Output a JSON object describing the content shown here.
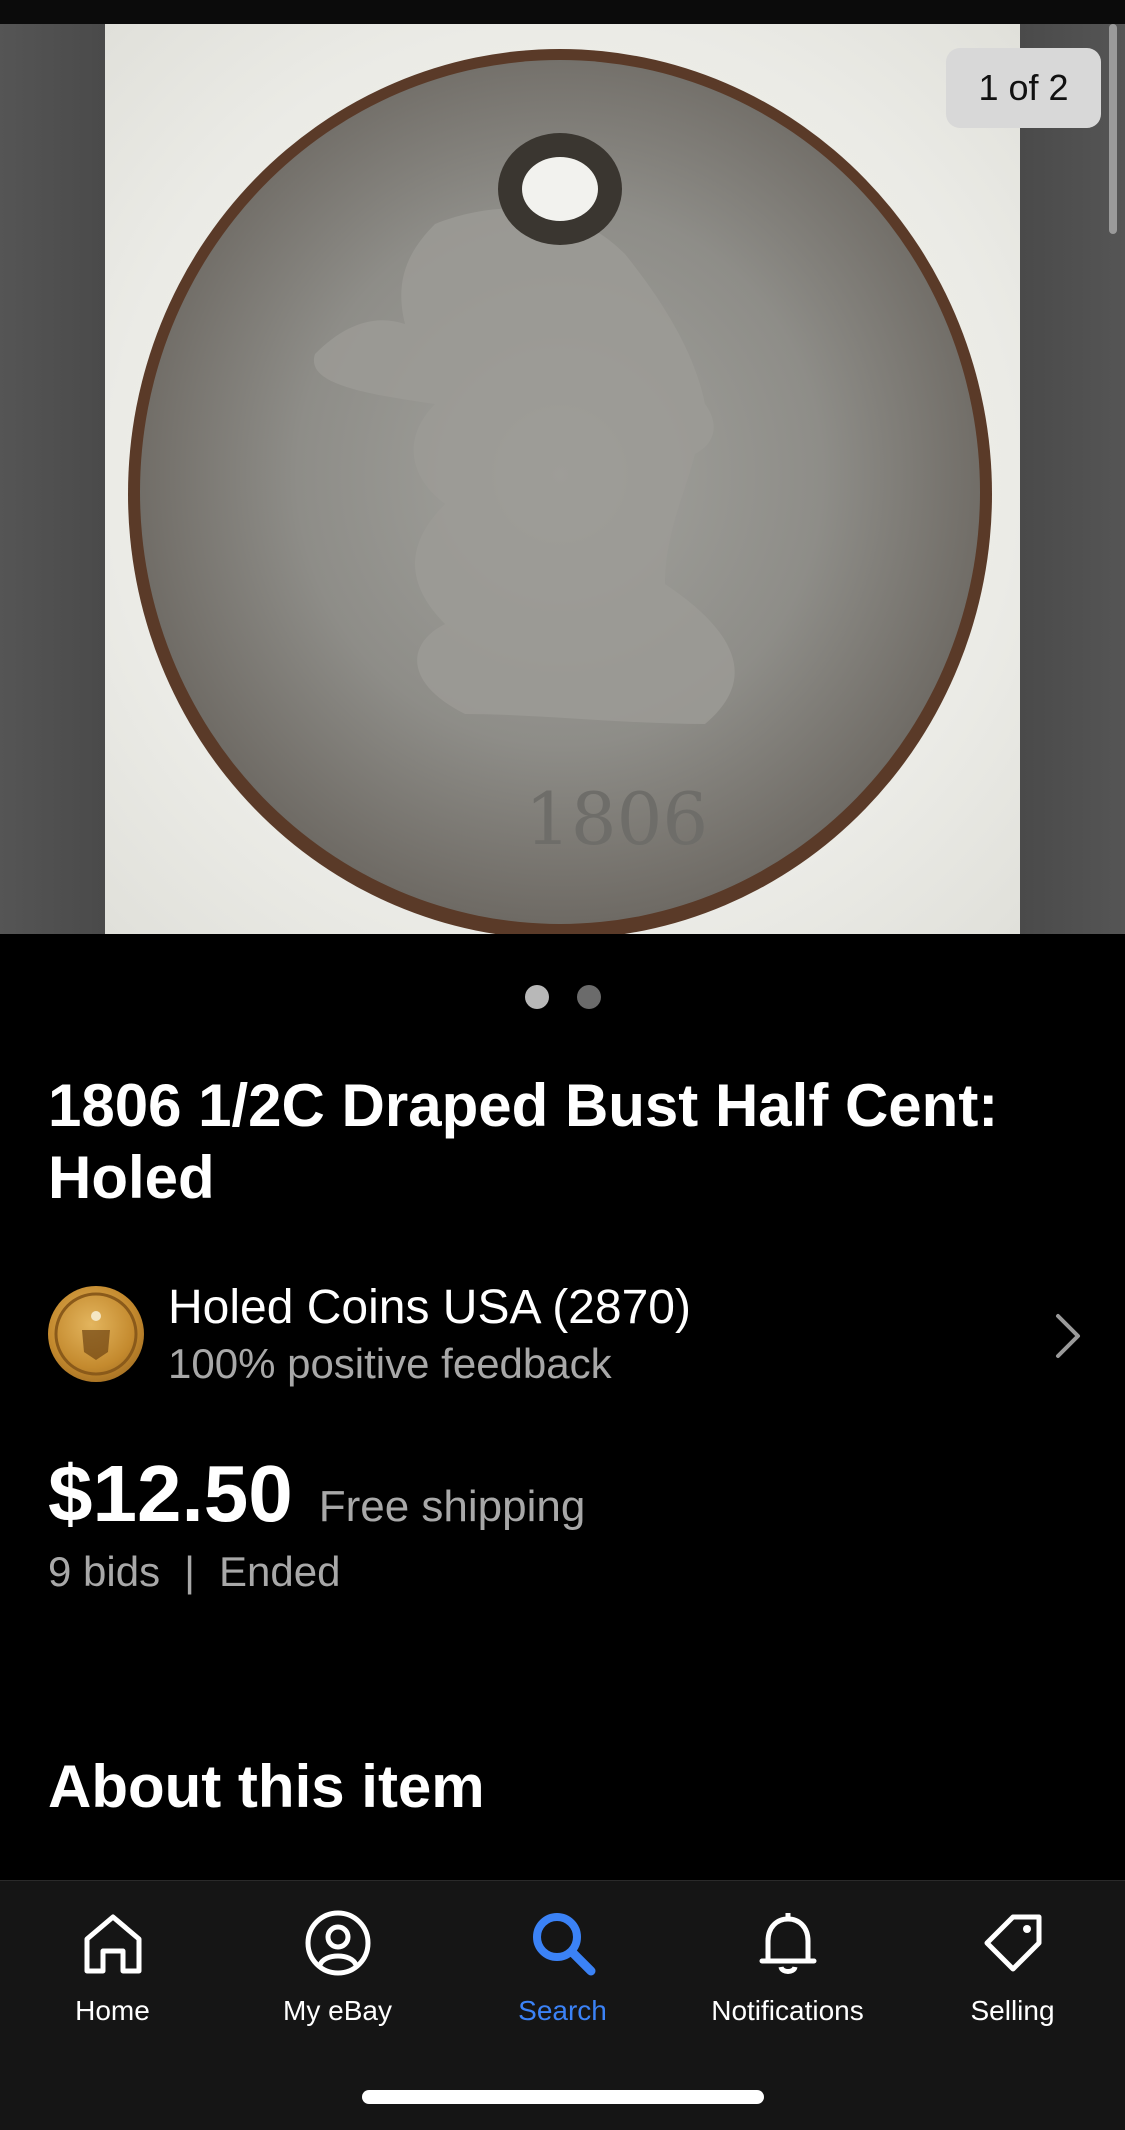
{
  "gallery": {
    "counter": "1 of 2",
    "total_images": 2,
    "active_index": 0,
    "coin_date_text": "1806"
  },
  "title": "1806 1/2C Draped Bust Half Cent: Holed",
  "seller": {
    "name": "Holed Coins USA (2870)",
    "feedback": "100% positive feedback",
    "avatar_icon": "coin-avatar-icon"
  },
  "price": {
    "amount": "$12.50",
    "shipping": "Free shipping",
    "bids": "9 bids",
    "separator": "|",
    "status": "Ended"
  },
  "about": {
    "heading": "About this item"
  },
  "nav": {
    "items": [
      {
        "label": "Home",
        "icon": "home-icon"
      },
      {
        "label": "My eBay",
        "icon": "user-circle-icon"
      },
      {
        "label": "Search",
        "icon": "search-icon"
      },
      {
        "label": "Notifications",
        "icon": "bell-icon"
      },
      {
        "label": "Selling",
        "icon": "tag-icon"
      }
    ],
    "active": "Search",
    "active_color": "#3b82f6"
  }
}
